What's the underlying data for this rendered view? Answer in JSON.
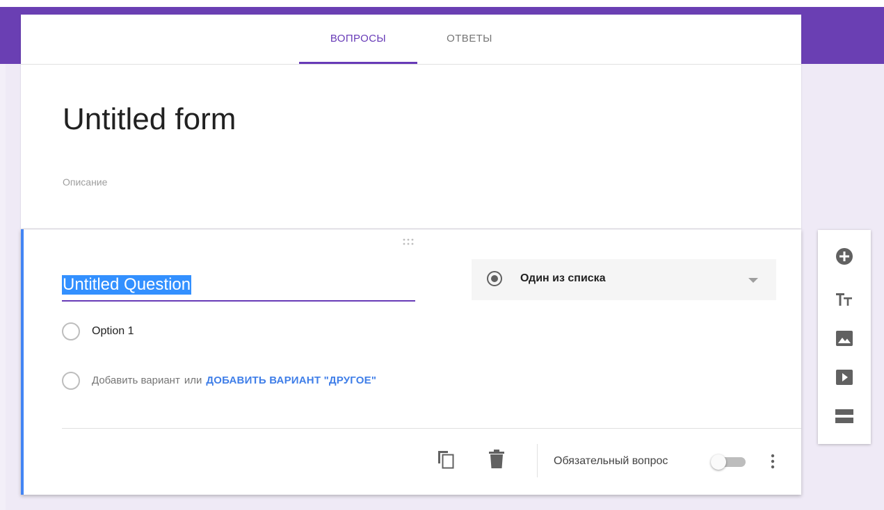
{
  "tabs": [
    {
      "label": "ВОПРОСЫ",
      "active": true
    },
    {
      "label": "ОТВЕТЫ",
      "active": false
    }
  ],
  "form": {
    "title": "Untitled form",
    "description_placeholder": "Описание"
  },
  "question": {
    "title": "Untitled Question",
    "type_label": "Один из списка",
    "options": [
      {
        "label": "Option 1"
      }
    ],
    "add_option_label": "Добавить вариант",
    "or_label": "или",
    "add_other_label": "ДОБАВИТЬ ВАРИАНТ \"ДРУГОЕ\"",
    "required_label": "Обязательный вопрос",
    "required": false
  },
  "toolbar_icons": [
    "add-circle-icon",
    "title-text-icon",
    "image-icon",
    "video-icon",
    "section-icon"
  ],
  "colors": {
    "brand": "#673ab7",
    "accent_blue": "#4285f4",
    "link_blue": "#3f7ee8"
  }
}
